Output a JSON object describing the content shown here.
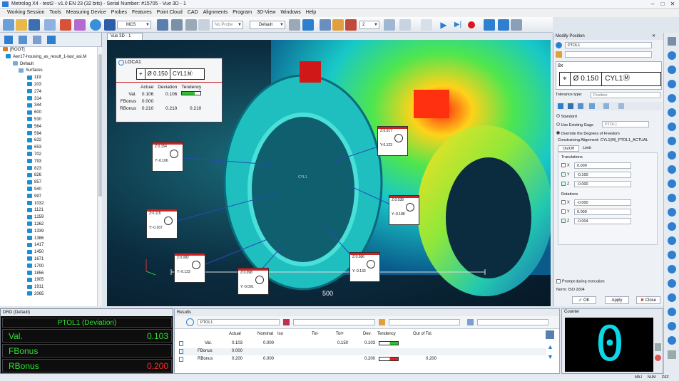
{
  "titlebar": {
    "title": "Metrolog X4 - test2 - v1.0 EN 23 (32 bits) - Serial Number: #15705 - Vue 3D - 1"
  },
  "menu": [
    "Working Session",
    "Tools",
    "Measuring Device",
    "Probes",
    "Features",
    "Point Cloud",
    "CAD",
    "Alignments",
    "Program",
    "3D-View",
    "Windows",
    "Help"
  ],
  "toolbar": {
    "frame_select": "MCS",
    "probe_select": "No Probe",
    "view_select": "Default",
    "count_value": "2"
  },
  "tree": {
    "root": "[ROOT]",
    "part": "Awr17-housing_as_result_1-last_asi.M",
    "default": "Default",
    "surfaces": "Surfaces",
    "items": [
      "119",
      "203",
      "274",
      "314",
      "344",
      "600",
      "530",
      "564",
      "594",
      "622",
      "653",
      "702",
      "793",
      "823",
      "826",
      "857",
      "940",
      "997",
      "1032",
      "1121",
      "1259",
      "1262",
      "1339",
      "1386",
      "1417",
      "1450",
      "1671",
      "1700",
      "1856",
      "1905",
      "1911",
      "2065"
    ]
  },
  "view": {
    "tab": "Vue 3D - 1",
    "scale_label": "500",
    "feature_label": "CYL1",
    "callouts": [
      {
        "z": "Z:0.154",
        "y": "Y:-0.106"
      },
      {
        "z": "Z:0.115",
        "y": "Y:-0.167"
      },
      {
        "z": "Z:0.082",
        "y": "Y:-0.123"
      },
      {
        "z": "Z:0.098",
        "y": "Y:-0.091"
      },
      {
        "z": "Z:0.017",
        "y": "Y:0.123"
      },
      {
        "z": "Z:0.038",
        "y": "Y:-0.188"
      },
      {
        "z": "Z:0.086",
        "y": "Y:-0.133"
      }
    ]
  },
  "loca": {
    "title": "LOCA1",
    "fcf_value": "Ø 0.150",
    "fcf_datum": "CYL1Ⓜ",
    "headers": [
      "",
      "Actual",
      "Deviation",
      "Tendency"
    ],
    "rows": [
      {
        "name": "Val.",
        "actual": "0.106",
        "deviation": "0.106",
        "tendency": ""
      },
      {
        "name": "FBonus",
        "actual": "0.000",
        "deviation": "",
        "tendency": ""
      },
      {
        "name": "RBonus",
        "actual": "0.210",
        "deviation": "0.210",
        "tendency": "0.210"
      }
    ]
  },
  "modify": {
    "title": "Modify Position",
    "feature": "PTOL1",
    "count": "8x",
    "fcf_value": "Ø 0.150",
    "fcf_datum": "CYL1Ⓜ",
    "tol_type_label": "Tolerance type:",
    "tol_type": "Position",
    "opt_standard": "Standard",
    "opt_gage": "Use Existing Gage",
    "gage_value": "PTOL1",
    "opt_override": "Override the Degrees of Freedom",
    "constraint": "Constraining Alignment: CYL1(M)_PTOL1_ACTUAL",
    "tab_onoff": "On/Off",
    "tab_limit": "Limit",
    "translations": "Translations",
    "trans": [
      {
        "axis": "X",
        "value": "0.000"
      },
      {
        "axis": "Y",
        "value": "-0.100"
      },
      {
        "axis": "Z",
        "value": "-0.000"
      }
    ],
    "rotations": "Rotations",
    "rots": [
      {
        "axis": "X",
        "value": "-0.000"
      },
      {
        "axis": "Y",
        "value": "0.000"
      },
      {
        "axis": "Z",
        "value": "-0.004"
      }
    ],
    "prompt": "Prompt during execution",
    "norm": "Norm: ISO 2004",
    "ok": "OK",
    "apply": "Apply",
    "close": "Close"
  },
  "dro": {
    "title": "DRO (Default)",
    "header": "PTOL1 (Deviation)",
    "rows": [
      {
        "label": "Val.",
        "value": "0.103",
        "color": "#2fe32f"
      },
      {
        "label": "FBonus",
        "value": "",
        "color": "#2fe32f"
      },
      {
        "label": "RBonus",
        "value": "0.200",
        "color": "#ff2a2a"
      }
    ]
  },
  "results": {
    "title": "Results",
    "feature": "PTOL1",
    "columns": [
      "Actual",
      "Nominal",
      "Iso",
      "Tol-",
      "Tol+",
      "Dev.",
      "Tendency",
      "Out of Tol."
    ],
    "rows": [
      {
        "name": "Val.",
        "actual": "0.103",
        "nominal": "0.000",
        "iso": "",
        "tolm": "",
        "tolp": "0.150",
        "dev": "0.103",
        "oot": ""
      },
      {
        "name": "FBonus",
        "actual": "0.000",
        "nominal": "",
        "iso": "",
        "tolm": "",
        "tolp": "",
        "dev": "",
        "oot": ""
      },
      {
        "name": "RBonus",
        "actual": "0.200",
        "nominal": "0.000",
        "iso": "",
        "tolm": "",
        "tolp": "",
        "dev": "0.200",
        "oot": "0.200"
      }
    ]
  },
  "counter": {
    "title": "Counter",
    "value": "0"
  },
  "status": {
    "maj": "MAJ",
    "num": "NUM",
    "def": "DEF"
  }
}
